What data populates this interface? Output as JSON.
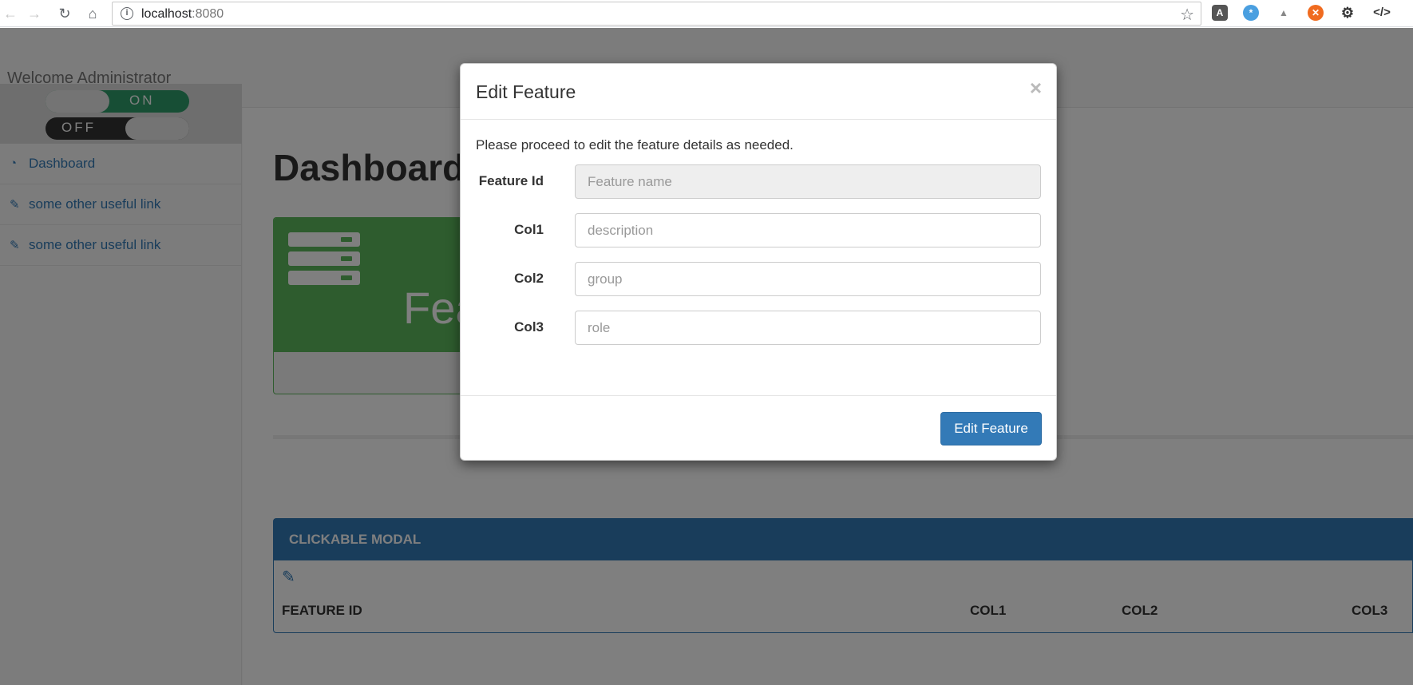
{
  "browser": {
    "url_host": "localhost",
    "url_port": ":8080"
  },
  "page": {
    "welcome": "Welcome Administrator",
    "toggle_on": "ON",
    "toggle_off": "OFF",
    "sidebar": [
      {
        "label": "Dashboard",
        "icon": "dashboard-icon"
      },
      {
        "label": "some other useful link",
        "icon": "edit-icon"
      },
      {
        "label": "some other useful link",
        "icon": "edit-icon"
      }
    ],
    "title": "Dashboard",
    "green_panel_text": "Fea",
    "blue_panel": {
      "title": "CLICKABLE MODAL",
      "columns": [
        "FEATURE ID",
        "COL1",
        "COL2",
        "COL3"
      ]
    }
  },
  "modal": {
    "title": "Edit Feature",
    "close": "×",
    "intro": "Please proceed to edit the feature details as needed.",
    "fields": [
      {
        "label": "Feature Id",
        "placeholder": "Feature name",
        "disabled": true
      },
      {
        "label": "Col1",
        "placeholder": "description",
        "disabled": false
      },
      {
        "label": "Col2",
        "placeholder": "group",
        "disabled": false
      },
      {
        "label": "Col3",
        "placeholder": "role",
        "disabled": false
      }
    ],
    "submit_label": "Edit Feature"
  },
  "colors": {
    "primary": "#337ab7",
    "success": "#5cb85c",
    "toggle_on": "#2e9c6a",
    "toggle_off": "#333333"
  }
}
